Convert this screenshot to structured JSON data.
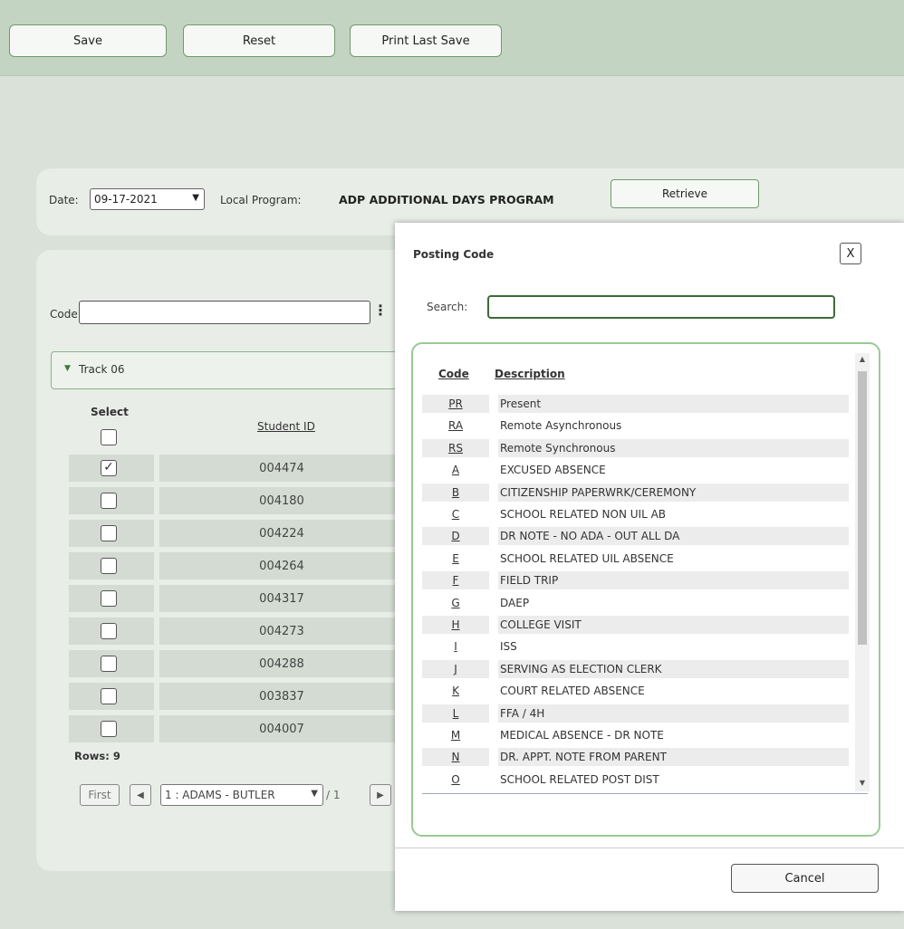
{
  "toolbar": {
    "save": "Save",
    "reset": "Reset",
    "print_last_save": "Print Last Save"
  },
  "filters": {
    "date_label": "Date:",
    "date_value": "09-17-2021",
    "local_program_label": "Local Program:",
    "local_program_value": "ADP ADDITIONAL DAYS PROGRAM",
    "retrieve": "Retrieve"
  },
  "code_filter": {
    "label": "Code:",
    "value": "",
    "more_icon": "vertical-ellipsis-icon"
  },
  "track": {
    "label": "Track 06",
    "toggle_icon": "caret-down-icon"
  },
  "table": {
    "select_header": "Select",
    "student_id_header": "Student ID",
    "rows": [
      {
        "student_id": "004474",
        "selected": true
      },
      {
        "student_id": "004180",
        "selected": false
      },
      {
        "student_id": "004224",
        "selected": false
      },
      {
        "student_id": "004264",
        "selected": false
      },
      {
        "student_id": "004317",
        "selected": false
      },
      {
        "student_id": "004273",
        "selected": false
      },
      {
        "student_id": "004288",
        "selected": false
      },
      {
        "student_id": "003837",
        "selected": false
      },
      {
        "student_id": "004007",
        "selected": false
      }
    ],
    "rows_count": "Rows: 9"
  },
  "pager": {
    "first": "First",
    "page_select": "1 : ADAMS - BUTLER",
    "total": "/ 1"
  },
  "modal": {
    "title": "Posting Code",
    "close": "X",
    "search_label": "Search:",
    "search_value": "",
    "code_header": "Code",
    "description_header": "Description",
    "rows": [
      {
        "code": "PR",
        "description": "Present"
      },
      {
        "code": "RA",
        "description": "Remote Asynchronous"
      },
      {
        "code": "RS",
        "description": "Remote Synchronous"
      },
      {
        "code": "A",
        "description": "EXCUSED ABSENCE"
      },
      {
        "code": "B",
        "description": "CITIZENSHIP PAPERWRK/CEREMONY"
      },
      {
        "code": "C",
        "description": "SCHOOL RELATED NON UIL AB"
      },
      {
        "code": "D",
        "description": "DR NOTE - NO ADA - OUT ALL DA"
      },
      {
        "code": "E",
        "description": "SCHOOL RELATED UIL ABSENCE"
      },
      {
        "code": "F",
        "description": "FIELD TRIP"
      },
      {
        "code": "G",
        "description": "DAEP"
      },
      {
        "code": "H",
        "description": "COLLEGE VISIT"
      },
      {
        "code": "I",
        "description": "ISS"
      },
      {
        "code": "J",
        "description": "SERVING AS ELECTION CLERK"
      },
      {
        "code": "K",
        "description": "COURT RELATED ABSENCE"
      },
      {
        "code": "L",
        "description": "FFA / 4H"
      },
      {
        "code": "M",
        "description": "MEDICAL ABSENCE - DR NOTE"
      },
      {
        "code": "N",
        "description": "DR. APPT. NOTE FROM PARENT"
      },
      {
        "code": "O",
        "description": "SCHOOL RELATED POST DIST"
      }
    ],
    "cancel": "Cancel"
  },
  "colors": {
    "toolbar_bg": "#c4d4c2",
    "page_bg": "#d9e1d9",
    "accent_green": "#6f9a6b",
    "listbox_border": "#9ac996"
  }
}
